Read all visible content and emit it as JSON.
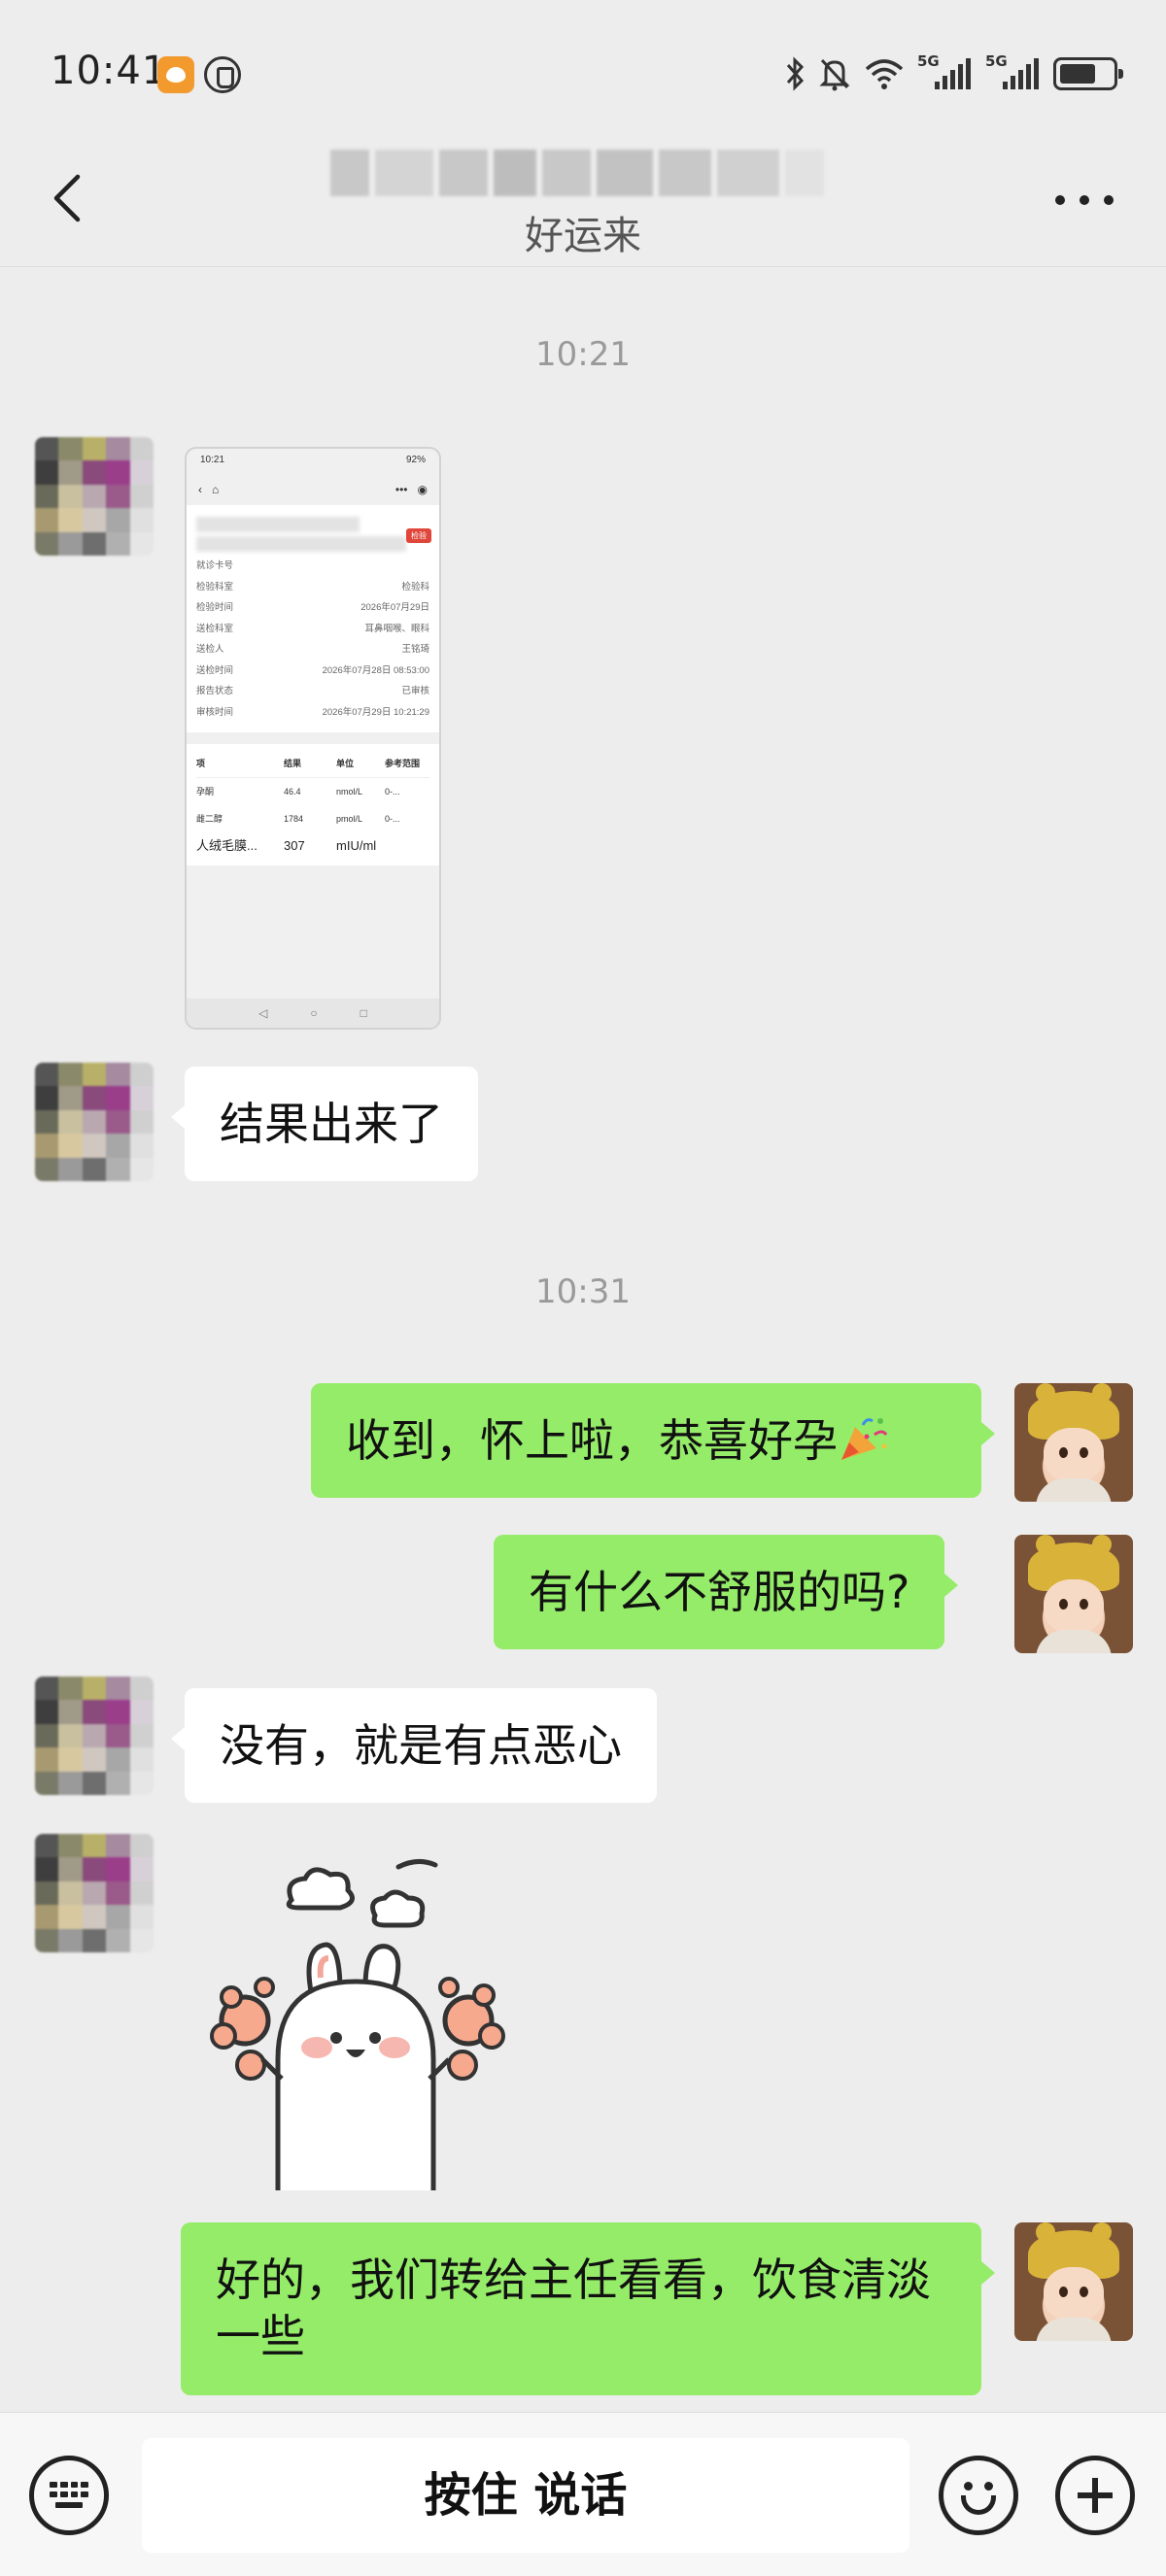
{
  "status_bar": {
    "time": "10:41",
    "network_1": "5G",
    "network_2": "5G"
  },
  "header": {
    "subtitle": "好运来"
  },
  "thumbnail": {
    "status_time": "10:21",
    "status_battery": "92%",
    "tag": "检验",
    "rows": [
      {
        "label": "就诊卡号",
        "value": ""
      },
      {
        "label": "检验科室",
        "value": "检验科"
      },
      {
        "label": "检验时间",
        "value": "2026年07月29日"
      },
      {
        "label": "送检科室",
        "value": "耳鼻咽喉、眼科"
      },
      {
        "label": "送检人",
        "value": "王铭琦"
      },
      {
        "label": "送检时间",
        "value": "2026年07月28日 08:53:00"
      },
      {
        "label": "报告状态",
        "value": "已审核"
      },
      {
        "label": "审核时间",
        "value": "2026年07月29日 10:21:29"
      }
    ],
    "table_headers": [
      "项",
      "结果",
      "单位",
      "参考范围"
    ],
    "table_rows": [
      {
        "item": "孕酮",
        "result": "46.4",
        "unit": "nmol/L",
        "range": "0-..."
      },
      {
        "item": "雌二醇",
        "result": "1784",
        "unit": "pmol/L",
        "range": "0-..."
      },
      {
        "item": "人绒毛膜...",
        "result": "307",
        "unit": "mIU/ml",
        "range": ""
      }
    ]
  },
  "chat": {
    "timestamp_1": "10:21",
    "msg_result": "结果出来了",
    "timestamp_2": "10:31",
    "msg_congrats": "收到，怀上啦，恭喜好孕",
    "msg_ask": "有什么不舒服的吗?",
    "msg_reply": "没有，就是有点恶心",
    "msg_final": "好的，我们转给主任看看，饮食清淡一些"
  },
  "input_bar": {
    "hold_to_talk": "按住 说话"
  },
  "colors": {
    "background": "#ededed",
    "bubble_self": "#95ec69",
    "bubble_other": "#ffffff"
  },
  "icons": [
    "back-arrow-icon",
    "more-icon",
    "keyboard-icon",
    "emoji-icon",
    "plus-icon",
    "party-popper-icon"
  ]
}
